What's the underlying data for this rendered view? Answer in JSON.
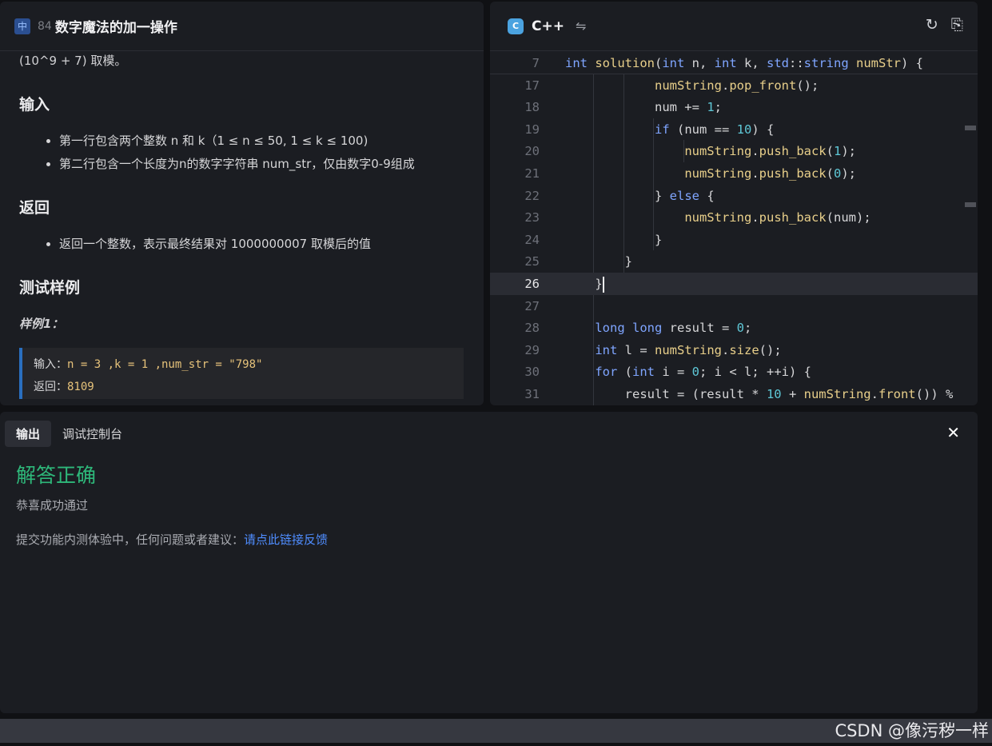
{
  "problem": {
    "lang_badge": "中",
    "id": "84",
    "title": "数字魔法的加一操作",
    "continuation": "(10^9 + 7) 取模。",
    "input_heading": "输入",
    "input_items": [
      "第一行包含两个整数 n 和 k（1 ≤ n ≤ 50, 1 ≤ k ≤ 100)",
      "第二行包含一个长度为n的数字字符串 num_str，仅由数字0-9组成"
    ],
    "return_heading": "返回",
    "return_items": [
      "返回一个整数，表示最终结果对 1000000007 取模后的值"
    ],
    "samples_heading": "测试样例",
    "sample_label": "样例1：",
    "sample_input_label": "输入：",
    "sample_input_value": "n = 3 ,k = 1 ,num_str = \"798\"",
    "sample_return_label": "返回：",
    "sample_return_value": "8109"
  },
  "editor": {
    "language": "C++",
    "icon_names": [
      "cpp-logo-icon",
      "swap-icon",
      "reset-icon",
      "format-icon"
    ],
    "active_line": "26",
    "lines": [
      {
        "n": "7",
        "tokens": [
          [
            "kw",
            "int"
          ],
          [
            "",
            ""
          ],
          [
            "fn",
            " solution"
          ],
          [
            "",
            "("
          ],
          [
            "kw",
            "int"
          ],
          [
            "",
            " n, "
          ],
          [
            "kw",
            "int"
          ],
          [
            "",
            " k, "
          ],
          [
            "kw",
            "std"
          ],
          [
            "",
            "::"
          ],
          [
            "kw",
            "string"
          ],
          [
            "",
            " "
          ],
          [
            "fn",
            "numStr"
          ],
          [
            "",
            ") {"
          ]
        ]
      },
      {
        "n": "17",
        "tokens": [
          [
            "",
            "            "
          ],
          [
            "fn",
            "numString"
          ],
          [
            "",
            "."
          ],
          [
            "fn",
            "pop_front"
          ],
          [
            "",
            "();"
          ]
        ]
      },
      {
        "n": "18",
        "tokens": [
          [
            "",
            "            num += "
          ],
          [
            "num",
            "1"
          ],
          [
            "",
            ";"
          ]
        ]
      },
      {
        "n": "19",
        "tokens": [
          [
            "",
            "            "
          ],
          [
            "kw",
            "if"
          ],
          [
            "",
            " (num == "
          ],
          [
            "num",
            "10"
          ],
          [
            "",
            ") {"
          ]
        ]
      },
      {
        "n": "20",
        "tokens": [
          [
            "",
            "                "
          ],
          [
            "fn",
            "numString"
          ],
          [
            "",
            "."
          ],
          [
            "fn",
            "push_back"
          ],
          [
            "",
            "("
          ],
          [
            "num",
            "1"
          ],
          [
            "",
            ");"
          ]
        ]
      },
      {
        "n": "21",
        "tokens": [
          [
            "",
            "                "
          ],
          [
            "fn",
            "numString"
          ],
          [
            "",
            "."
          ],
          [
            "fn",
            "push_back"
          ],
          [
            "",
            "("
          ],
          [
            "num",
            "0"
          ],
          [
            "",
            ");"
          ]
        ]
      },
      {
        "n": "22",
        "tokens": [
          [
            "",
            "            } "
          ],
          [
            "kw",
            "else"
          ],
          [
            "",
            " {"
          ]
        ]
      },
      {
        "n": "23",
        "tokens": [
          [
            "",
            "                "
          ],
          [
            "fn",
            "numString"
          ],
          [
            "",
            "."
          ],
          [
            "fn",
            "push_back"
          ],
          [
            "",
            "(num);"
          ]
        ]
      },
      {
        "n": "24",
        "tokens": [
          [
            "",
            "            }"
          ]
        ]
      },
      {
        "n": "25",
        "tokens": [
          [
            "",
            "        }"
          ]
        ]
      },
      {
        "n": "26",
        "tokens": [
          [
            "",
            "    }"
          ]
        ]
      },
      {
        "n": "27",
        "tokens": [
          [
            "",
            ""
          ]
        ]
      },
      {
        "n": "28",
        "tokens": [
          [
            "",
            "    "
          ],
          [
            "kw",
            "long"
          ],
          [
            "",
            " "
          ],
          [
            "kw",
            "long"
          ],
          [
            "",
            " result = "
          ],
          [
            "num",
            "0"
          ],
          [
            "",
            ";"
          ]
        ]
      },
      {
        "n": "29",
        "tokens": [
          [
            "",
            "    "
          ],
          [
            "kw",
            "int"
          ],
          [
            "",
            " l = "
          ],
          [
            "fn",
            "numString"
          ],
          [
            "",
            "."
          ],
          [
            "fn",
            "size"
          ],
          [
            "",
            "();"
          ]
        ]
      },
      {
        "n": "30",
        "tokens": [
          [
            "",
            "    "
          ],
          [
            "kw",
            "for"
          ],
          [
            "",
            " ("
          ],
          [
            "kw",
            "int"
          ],
          [
            "",
            " i = "
          ],
          [
            "num",
            "0"
          ],
          [
            "",
            "; i < l; ++i) {"
          ]
        ]
      },
      {
        "n": "31",
        "tokens": [
          [
            "",
            "        result = (result * "
          ],
          [
            "num",
            "10"
          ],
          [
            "",
            " + "
          ],
          [
            "fn",
            "numString"
          ],
          [
            "",
            "."
          ],
          [
            "fn",
            "front"
          ],
          [
            "",
            "()) %"
          ]
        ]
      }
    ]
  },
  "output": {
    "tabs": [
      "输出",
      "调试控制台"
    ],
    "verdict": "解答正确",
    "verdict_sub": "恭喜成功通过",
    "feedback_text": "提交功能内测体验中，任何问题或者建议：",
    "feedback_link": "请点此链接反馈"
  },
  "watermark": "CSDN @像污秽一样",
  "colors": {
    "accent_green": "#2eb87a",
    "link_blue": "#4f8dff",
    "sample_border": "#2a6fbf"
  }
}
